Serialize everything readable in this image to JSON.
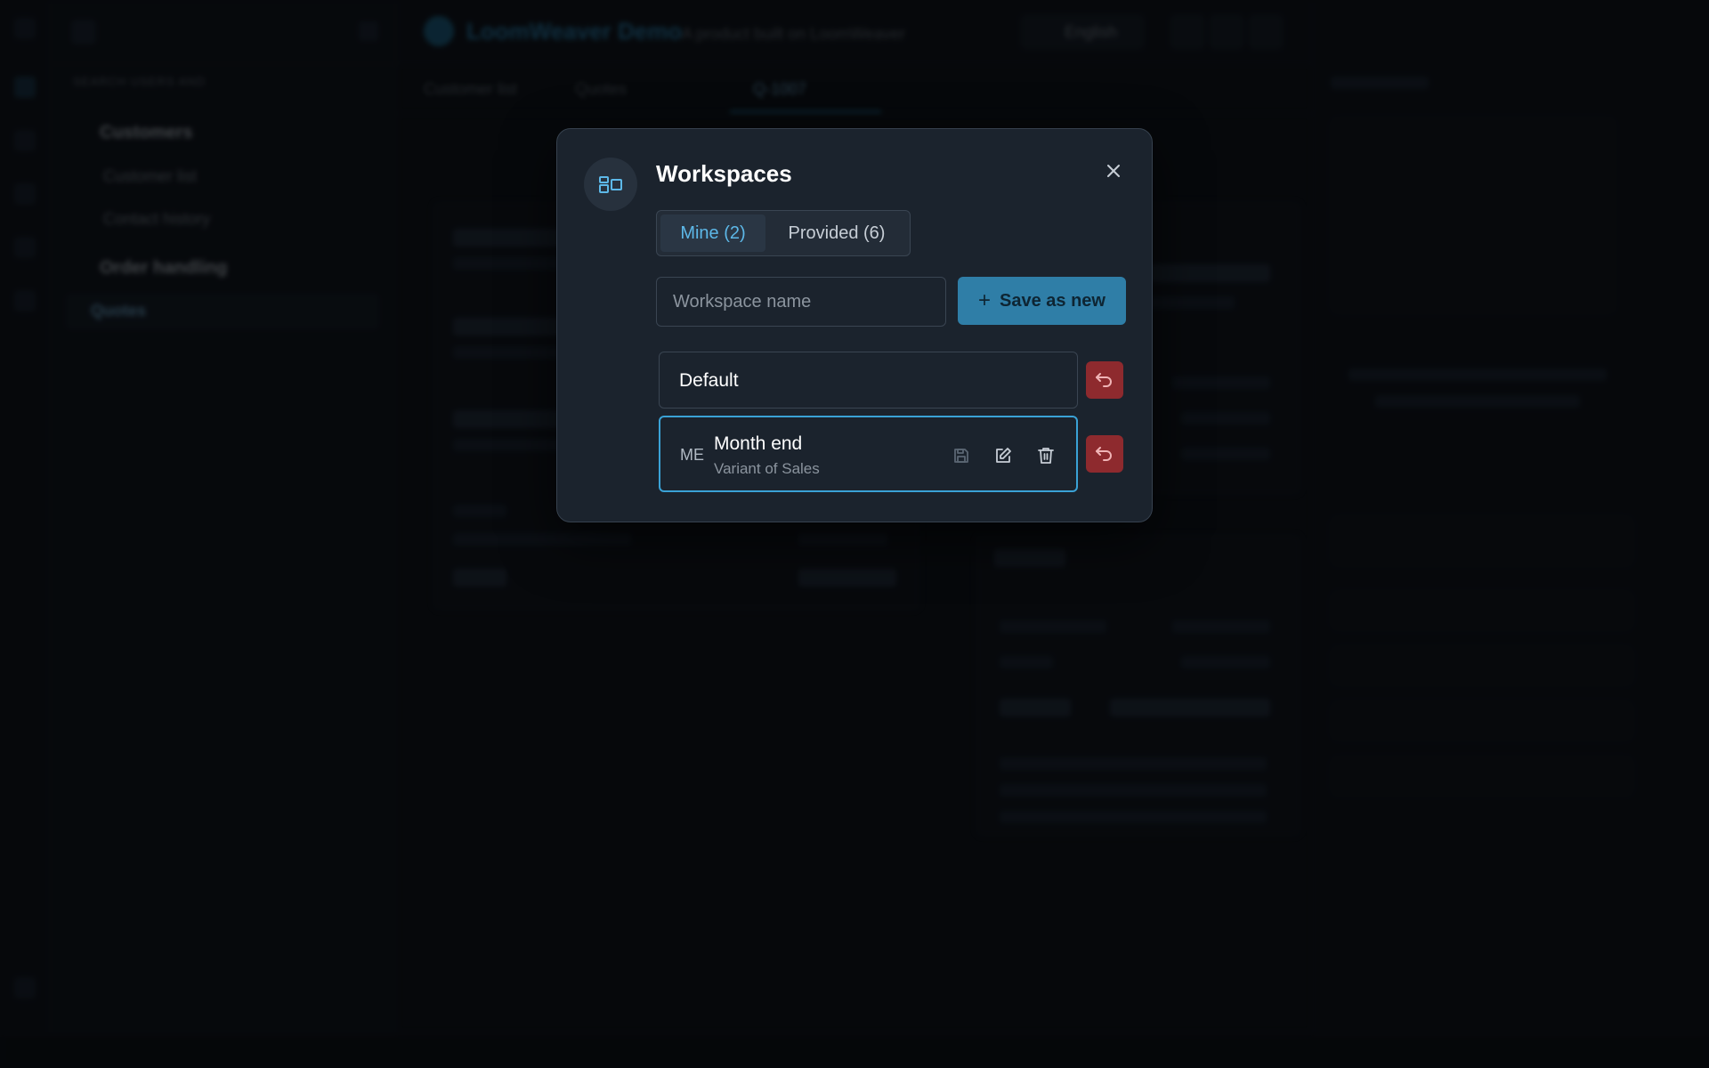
{
  "app": {
    "brand": "LoomWeaver Demo",
    "brand_sub": "A product built on LoomWeaver",
    "language": "English"
  },
  "sidebar": {
    "section_label": "SEARCH USERS AND",
    "items": [
      {
        "label": "Customers"
      },
      {
        "label": "Customer list"
      },
      {
        "label": "Contact history"
      },
      {
        "label": "Order handling"
      },
      {
        "label": "Quotes"
      }
    ]
  },
  "tabs": [
    {
      "label": "Customer list"
    },
    {
      "label": "Quotes"
    },
    {
      "label": "Q-1007"
    }
  ],
  "modal": {
    "title": "Workspaces",
    "icon": "layout-icon",
    "segments": [
      {
        "label": "Mine (2)",
        "active": true
      },
      {
        "label": "Provided (6)",
        "active": false
      }
    ],
    "name_placeholder": "Workspace name",
    "save_as_new_label": "Save as new",
    "workspaces": [
      {
        "name": "Default"
      },
      {
        "abbr": "ME",
        "name": "Month end",
        "subtitle": "Variant of Sales",
        "selected": true
      }
    ]
  },
  "colors": {
    "accent": "#3aa2d6",
    "primary_button": "#2f7ea7",
    "danger": "#8e2a2e",
    "modal_bg": "#1b232d"
  }
}
